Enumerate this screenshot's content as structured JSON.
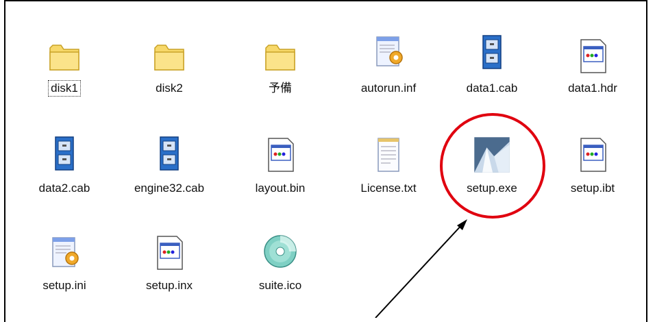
{
  "files": [
    {
      "label": "disk1",
      "icon": "folder-icon"
    },
    {
      "label": "disk2",
      "icon": "folder-icon"
    },
    {
      "label": "予備",
      "icon": "folder-icon"
    },
    {
      "label": "autorun.inf",
      "icon": "settings-file-icon"
    },
    {
      "label": "data1.cab",
      "icon": "cabinet-icon"
    },
    {
      "label": "data1.hdr",
      "icon": "generic-file-icon"
    },
    {
      "label": "data2.cab",
      "icon": "cabinet-icon"
    },
    {
      "label": "engine32.cab",
      "icon": "cabinet-icon"
    },
    {
      "label": "layout.bin",
      "icon": "generic-file-icon"
    },
    {
      "label": "License.txt",
      "icon": "text-file-icon"
    },
    {
      "label": "setup.exe",
      "icon": "setup-exe-icon"
    },
    {
      "label": "setup.ibt",
      "icon": "generic-file-icon"
    },
    {
      "label": "setup.ini",
      "icon": "settings-file-icon"
    },
    {
      "label": "setup.inx",
      "icon": "generic-file-icon"
    },
    {
      "label": "suite.ico",
      "icon": "cd-icon"
    }
  ],
  "selected_item": "disk1",
  "highlighted_item": "setup.exe",
  "colors": {
    "annotation": "#e0000f",
    "folder": "#f7d86a",
    "cabinet": "#2a6fc8"
  }
}
